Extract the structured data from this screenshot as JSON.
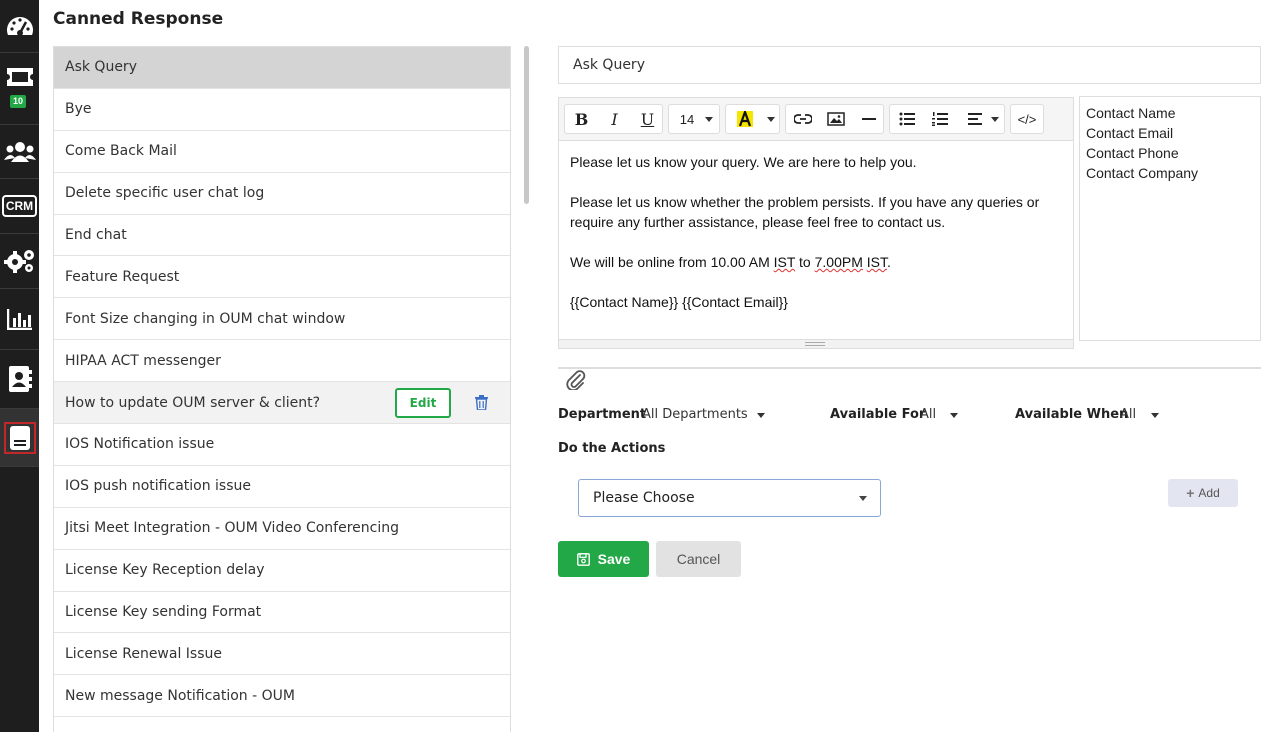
{
  "sidebar": {
    "items": [
      {
        "icon": "dashboard-gauge-icon"
      },
      {
        "icon": "ticket-icon",
        "badge": "10"
      },
      {
        "icon": "users-group-icon"
      },
      {
        "icon": "crm-icon",
        "label": "CRM"
      },
      {
        "icon": "gears-icon"
      },
      {
        "icon": "bar-chart-icon"
      },
      {
        "icon": "contact-book-icon"
      },
      {
        "icon": "canned-response-icon",
        "active": true
      }
    ]
  },
  "page": {
    "title": "Canned Response"
  },
  "responses": [
    {
      "label": "Ask Query"
    },
    {
      "label": "Bye"
    },
    {
      "label": "Come Back Mail"
    },
    {
      "label": "Delete specific user chat log"
    },
    {
      "label": "End chat"
    },
    {
      "label": "Feature Request"
    },
    {
      "label": "Font Size changing in OUM chat window"
    },
    {
      "label": "HIPAA ACT messenger"
    },
    {
      "label": "How to update OUM server & client?"
    },
    {
      "label": "IOS Notification issue"
    },
    {
      "label": "IOS push notification issue"
    },
    {
      "label": "Jitsi Meet Integration - OUM Video Conferencing"
    },
    {
      "label": "License Key Reception delay"
    },
    {
      "label": "License Key sending Format"
    },
    {
      "label": "License Renewal Issue"
    },
    {
      "label": "New message Notification - OUM"
    }
  ],
  "row_actions": {
    "edit_label": "Edit"
  },
  "form": {
    "title_value": "Ask Query",
    "font_size": "14",
    "body": {
      "line1": "Please let us know your query. We are here to help you.",
      "line2": "Please let us know whether the problem persists. If you have any queries or require any further assistance, please feel free to contact us.",
      "line3_pre": "We will be online from 10.00 AM ",
      "line3_ist1": "IST",
      "line3_mid": " to ",
      "line3_time": "7.00PM",
      "line3_sp": " ",
      "line3_ist2": "IST",
      "line3_end": ".",
      "line4": "{{Contact Name}} {{Contact Email}}"
    },
    "placeholders": [
      "Contact Name",
      "Contact Email",
      "Contact Phone",
      "Contact Company"
    ],
    "department_label": "Department",
    "department_value": "All Departments",
    "available_for_label": "Available For",
    "available_for_value": "All",
    "available_when_label": "Available When",
    "available_when_value": "All",
    "actions_label": "Do the Actions",
    "action_select": "Please Choose",
    "add_label": "Add",
    "save_label": "Save",
    "cancel_label": "Cancel"
  },
  "colors": {
    "accent": "#22a846",
    "sidebar": "#1e1e1e",
    "selected_row": "#d4d4d4"
  }
}
